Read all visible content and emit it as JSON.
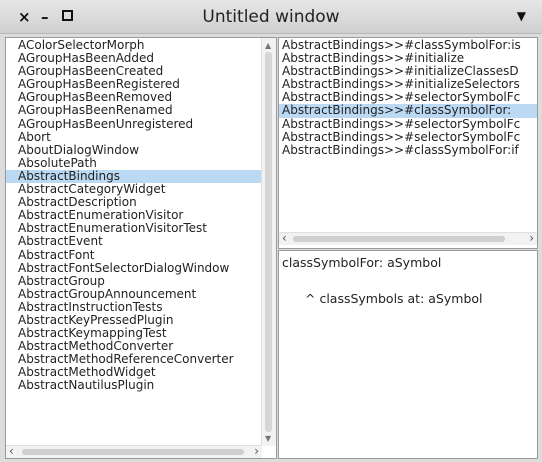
{
  "window": {
    "title": "Untitled window",
    "close_glyph": "×",
    "minimize_glyph": "–",
    "menu_glyph": "▼"
  },
  "class_list": {
    "selected_index": 10,
    "items": [
      "AColorSelectorMorph",
      "AGroupHasBeenAdded",
      "AGroupHasBeenCreated",
      "AGroupHasBeenRegistered",
      "AGroupHasBeenRemoved",
      "AGroupHasBeenRenamed",
      "AGroupHasBeenUnregistered",
      "Abort",
      "AboutDialogWindow",
      "AbsolutePath",
      "AbstractBindings",
      "AbstractCategoryWidget",
      "AbstractDescription",
      "AbstractEnumerationVisitor",
      "AbstractEnumerationVisitorTest",
      "AbstractEvent",
      "AbstractFont",
      "AbstractFontSelectorDialogWindow",
      "AbstractGroup",
      "AbstractGroupAnnouncement",
      "AbstractInstructionTests",
      "AbstractKeyPressedPlugin",
      "AbstractKeymappingTest",
      "AbstractMethodConverter",
      "AbstractMethodReferenceConverter",
      "AbstractMethodWidget",
      "AbstractNautilusPlugin"
    ]
  },
  "method_list": {
    "selected_index": 5,
    "items": [
      "AbstractBindings>>#classSymbolFor:is",
      "AbstractBindings>>#initialize",
      "AbstractBindings>>#initializeClassesD",
      "AbstractBindings>>#initializeSelectors",
      "AbstractBindings>>#selectorSymbolFc",
      "AbstractBindings>>#classSymbolFor:",
      "AbstractBindings>>#selectorSymbolFc",
      "AbstractBindings>>#selectorSymbolFc",
      "AbstractBindings>>#classSymbolFor:if"
    ]
  },
  "source": {
    "signature": "classSymbolFor: aSymbol",
    "body": "^ classSymbols at: aSymbol"
  },
  "icons": {
    "scroll_up": "up-arrow",
    "scroll_down": "down-arrow",
    "scroll_left": "left-arrow",
    "scroll_right": "right-arrow"
  },
  "colors": {
    "selection": "#bcd9f4",
    "title_bar": "#dcdcdc"
  }
}
